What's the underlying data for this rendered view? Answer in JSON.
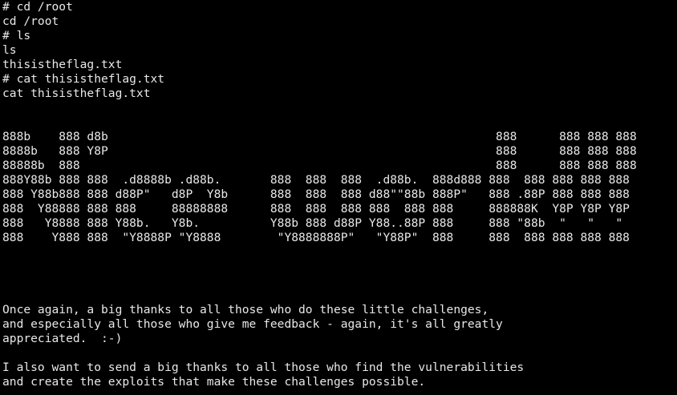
{
  "terminal": {
    "background": "#000000",
    "foreground": "#e8e8e8",
    "lines": [
      "# cd /root",
      "cd /root",
      "# ls",
      "ls",
      "thisistheflag.txt",
      "# cat thisistheflag.txt",
      "cat thisistheflag.txt",
      "",
      "",
      "888b    888 d8b                                                       888      888 888 888",
      "8888b   888 Y8P                                                       888      888 888 888",
      "88888b  888                                                           888      888 888 888",
      "888Y88b 888 888  .d8888b .d88b.       888  888  888  .d88b.  888d888 888  888 888 888 888",
      "888 Y88b888 888 d88P\"   d8P  Y8b      888  888  888 d88\"\"88b 888P\"   888 .88P 888 888 888",
      "888  Y88888 888 888     88888888      888  888  888 888  888 888     888888K  Y8P Y8P Y8P",
      "888   Y8888 888 Y88b.   Y8b.          Y88b 888 d88P Y88..88P 888     888 \"88b  \"   \"   \"",
      "888    Y888 888  \"Y8888P \"Y8888        \"Y8888888P\"   \"Y88P\"  888     888  888 888 888 888",
      "",
      "",
      "",
      "",
      "Once again, a big thanks to all those who do these little challenges,",
      "and especially all those who give me feedback - again, it's all greatly",
      "appreciated.  :-)",
      "",
      "I also want to send a big thanks to all those who find the vulnerabilities",
      "and create the exploits that make these challenges possible."
    ]
  }
}
